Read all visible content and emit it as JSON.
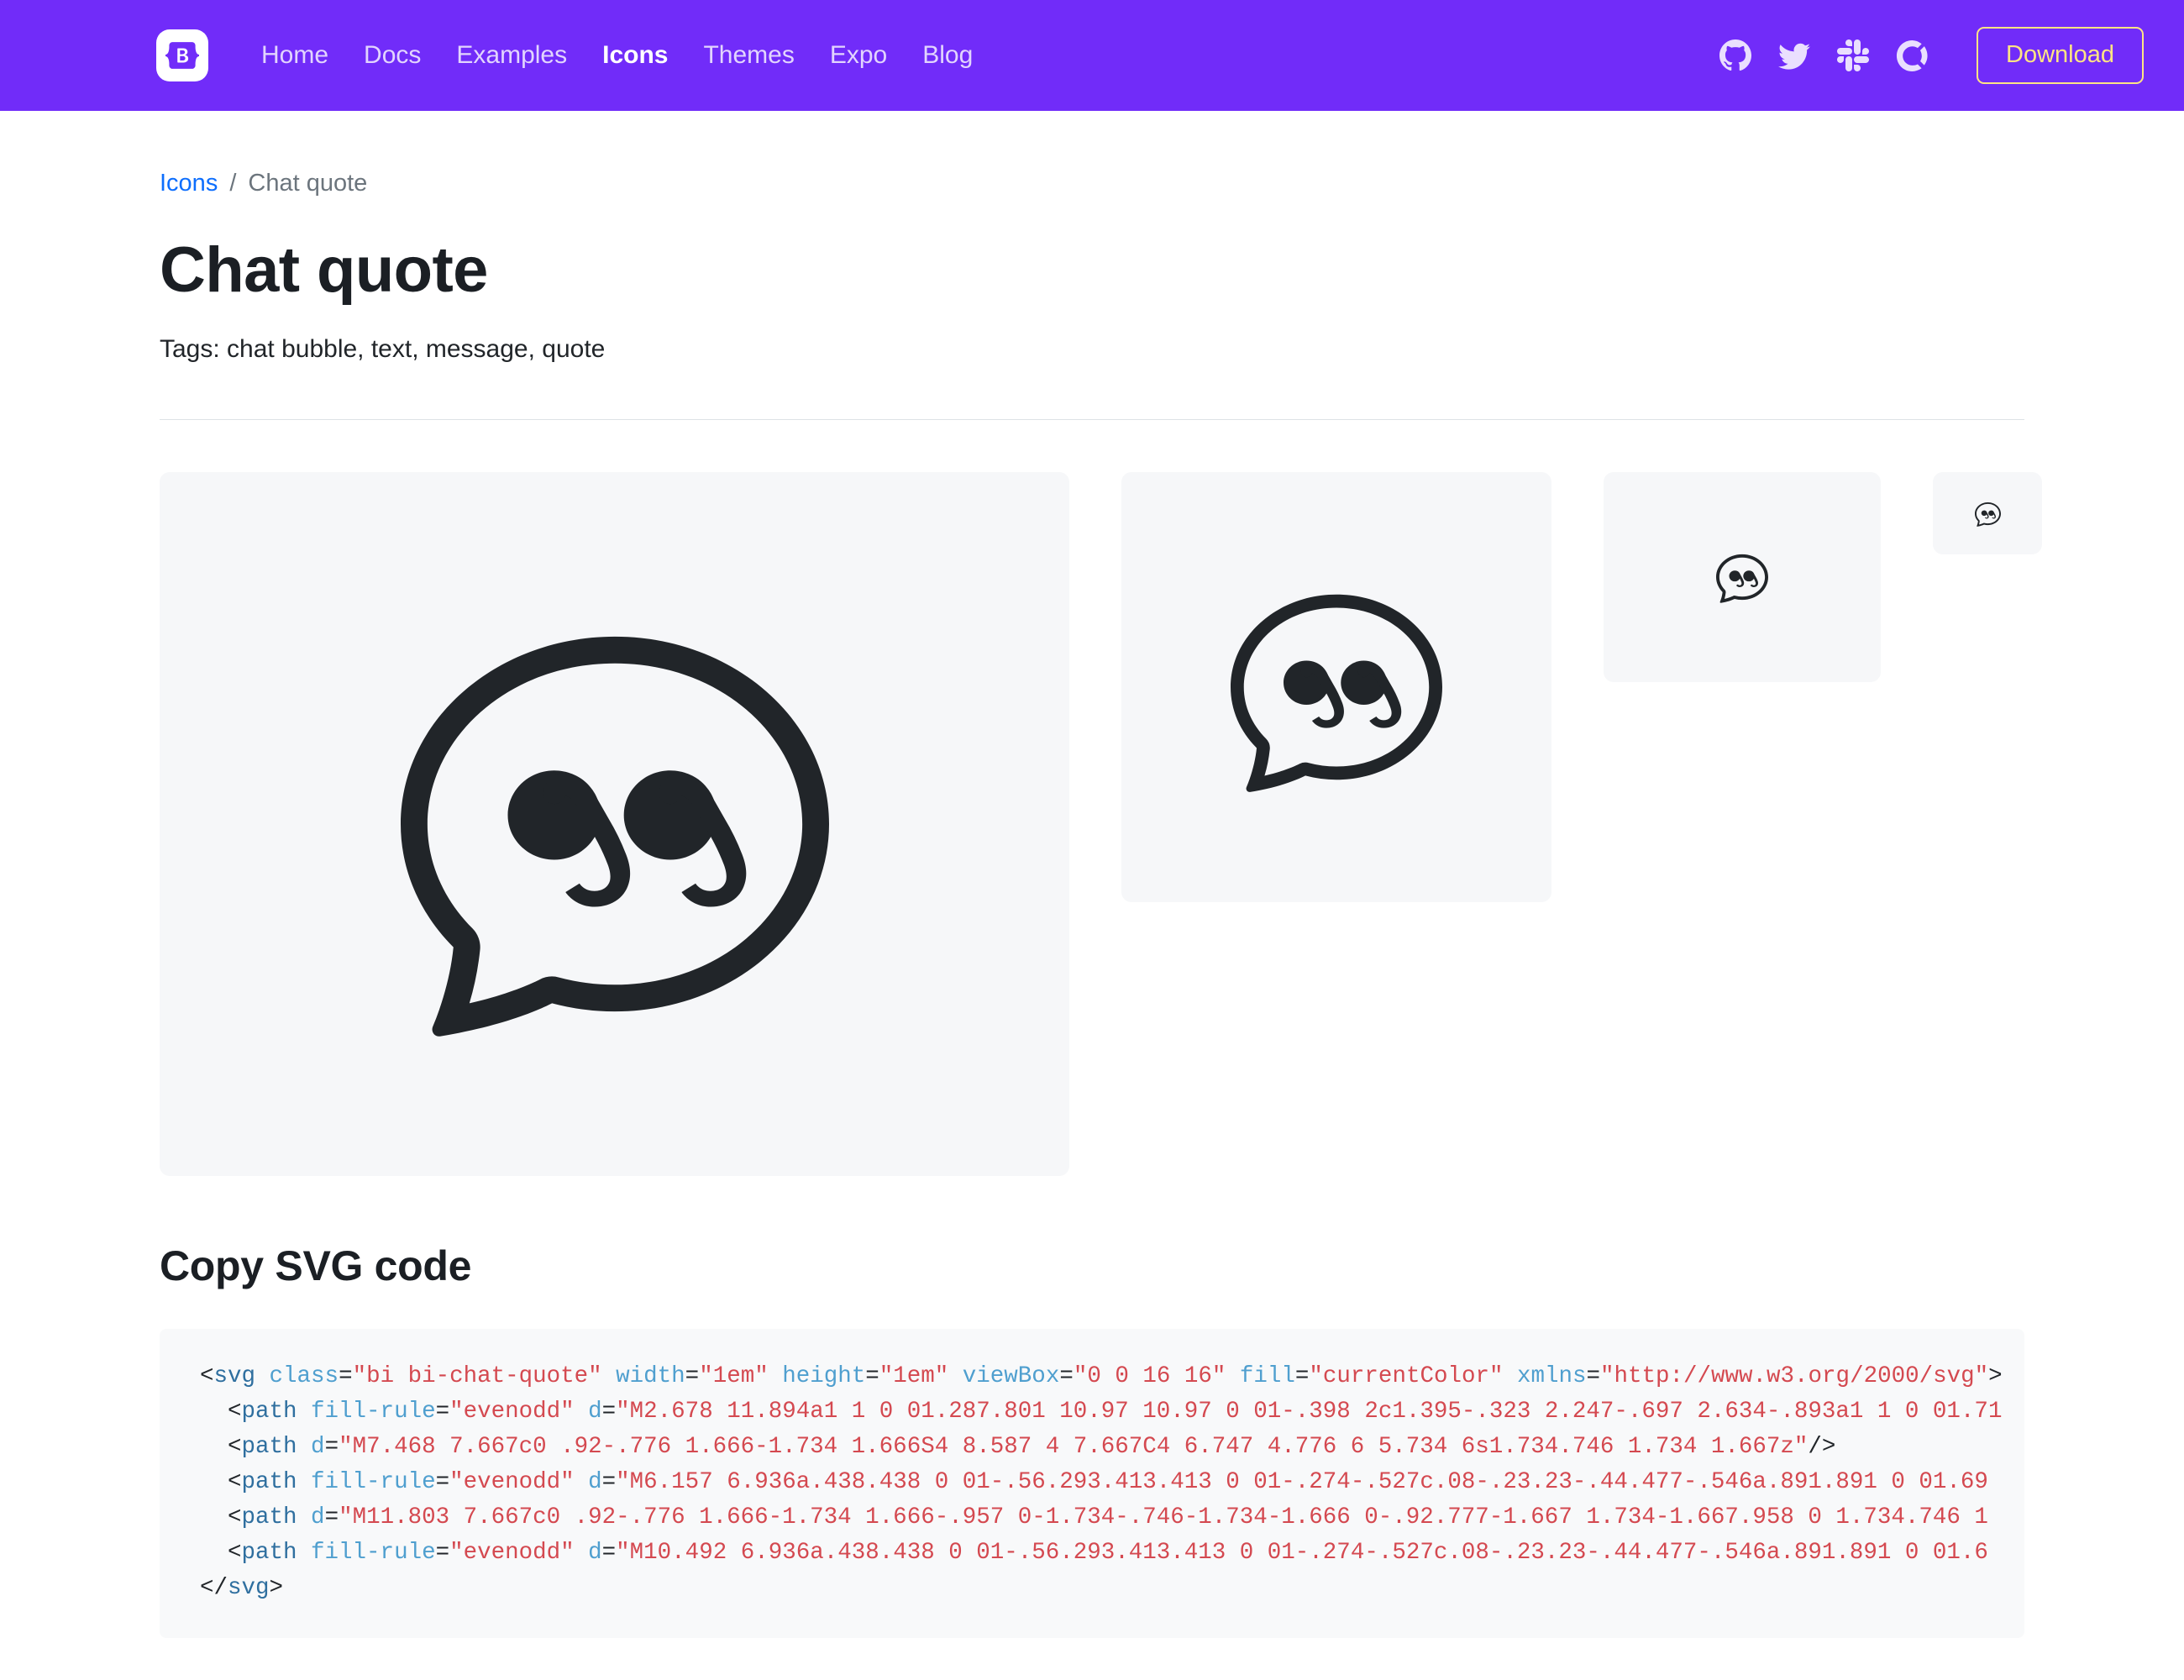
{
  "navbar": {
    "brand_letter": "B",
    "brand_name": "bootstrap-logo",
    "links": [
      {
        "label": "Home",
        "active": false
      },
      {
        "label": "Docs",
        "active": false
      },
      {
        "label": "Examples",
        "active": false
      },
      {
        "label": "Icons",
        "active": true
      },
      {
        "label": "Themes",
        "active": false
      },
      {
        "label": "Expo",
        "active": false
      },
      {
        "label": "Blog",
        "active": false
      }
    ],
    "social": [
      {
        "icon": "github-icon",
        "name": "GitHub"
      },
      {
        "icon": "twitter-icon",
        "name": "Twitter"
      },
      {
        "icon": "slack-icon",
        "name": "Slack"
      },
      {
        "icon": "open-collective-icon",
        "name": "Open Collective"
      }
    ],
    "download_label": "Download",
    "bg_color": "#712cf9",
    "download_color": "#ffe484"
  },
  "breadcrumb": {
    "parent": "Icons",
    "separator": "/",
    "current": "Chat quote"
  },
  "page": {
    "title": "Chat quote",
    "tags_label": "Tags:",
    "tags": "chat bubble, text, message, quote",
    "tags_line": "Tags: chat bubble, text, message, quote"
  },
  "previews": {
    "box_bg": "#f6f7f9",
    "icon_color": "#212529",
    "items": [
      {
        "size_label": "8rem",
        "px": 211
      },
      {
        "size_label": "4rem",
        "px": 105
      },
      {
        "size_label": "2rem",
        "px": 53
      },
      {
        "size_label": "1rem",
        "px": 26
      }
    ]
  },
  "code_section": {
    "heading": "Copy SVG code",
    "bg_color": "#f8f9fa",
    "lines": [
      [
        {
          "t": "tg",
          "v": "<"
        },
        {
          "t": "nm",
          "v": "svg"
        },
        {
          "t": "tg",
          "v": " "
        },
        {
          "t": "at",
          "v": "class"
        },
        {
          "t": "eq",
          "v": "="
        },
        {
          "t": "st",
          "v": "\"bi bi-chat-quote\""
        },
        {
          "t": "tg",
          "v": " "
        },
        {
          "t": "at",
          "v": "width"
        },
        {
          "t": "eq",
          "v": "="
        },
        {
          "t": "st",
          "v": "\"1em\""
        },
        {
          "t": "tg",
          "v": " "
        },
        {
          "t": "at",
          "v": "height"
        },
        {
          "t": "eq",
          "v": "="
        },
        {
          "t": "st",
          "v": "\"1em\""
        },
        {
          "t": "tg",
          "v": " "
        },
        {
          "t": "at",
          "v": "viewBox"
        },
        {
          "t": "eq",
          "v": "="
        },
        {
          "t": "st",
          "v": "\"0 0 16 16\""
        },
        {
          "t": "tg",
          "v": " "
        },
        {
          "t": "at",
          "v": "fill"
        },
        {
          "t": "eq",
          "v": "="
        },
        {
          "t": "st",
          "v": "\"currentColor\""
        },
        {
          "t": "tg",
          "v": " "
        },
        {
          "t": "at",
          "v": "xmlns"
        },
        {
          "t": "eq",
          "v": "="
        },
        {
          "t": "st",
          "v": "\"http://www.w3.org/2000/svg\""
        },
        {
          "t": "tg",
          "v": ">"
        }
      ],
      [
        {
          "t": "tg",
          "v": "  <"
        },
        {
          "t": "nm",
          "v": "path"
        },
        {
          "t": "tg",
          "v": " "
        },
        {
          "t": "at",
          "v": "fill-rule"
        },
        {
          "t": "eq",
          "v": "="
        },
        {
          "t": "st",
          "v": "\"evenodd\""
        },
        {
          "t": "tg",
          "v": " "
        },
        {
          "t": "at",
          "v": "d"
        },
        {
          "t": "eq",
          "v": "="
        },
        {
          "t": "st",
          "v": "\"M2.678 11.894a1 1 0 01.287.801 10.97 10.97 0 01-.398 2c1.395-.323 2.247-.697 2.634-.893a1 1 0 01.71"
        }
      ],
      [
        {
          "t": "tg",
          "v": "  <"
        },
        {
          "t": "nm",
          "v": "path"
        },
        {
          "t": "tg",
          "v": " "
        },
        {
          "t": "at",
          "v": "d"
        },
        {
          "t": "eq",
          "v": "="
        },
        {
          "t": "st",
          "v": "\"M7.468 7.667c0 .92-.776 1.666-1.734 1.666S4 8.587 4 7.667C4 6.747 4.776 6 5.734 6s1.734.746 1.734 1.667z\""
        },
        {
          "t": "tg",
          "v": "/>"
        }
      ],
      [
        {
          "t": "tg",
          "v": "  <"
        },
        {
          "t": "nm",
          "v": "path"
        },
        {
          "t": "tg",
          "v": " "
        },
        {
          "t": "at",
          "v": "fill-rule"
        },
        {
          "t": "eq",
          "v": "="
        },
        {
          "t": "st",
          "v": "\"evenodd\""
        },
        {
          "t": "tg",
          "v": " "
        },
        {
          "t": "at",
          "v": "d"
        },
        {
          "t": "eq",
          "v": "="
        },
        {
          "t": "st",
          "v": "\"M6.157 6.936a.438.438 0 01-.56.293.413.413 0 01-.274-.527c.08-.23.23-.44.477-.546a.891.891 0 01.69"
        }
      ],
      [
        {
          "t": "tg",
          "v": "  <"
        },
        {
          "t": "nm",
          "v": "path"
        },
        {
          "t": "tg",
          "v": " "
        },
        {
          "t": "at",
          "v": "d"
        },
        {
          "t": "eq",
          "v": "="
        },
        {
          "t": "st",
          "v": "\"M11.803 7.667c0 .92-.776 1.666-1.734 1.666-.957 0-1.734-.746-1.734-1.666 0-.92.777-1.667 1.734-1.667.958 0 1.734.746 1"
        }
      ],
      [
        {
          "t": "tg",
          "v": "  <"
        },
        {
          "t": "nm",
          "v": "path"
        },
        {
          "t": "tg",
          "v": " "
        },
        {
          "t": "at",
          "v": "fill-rule"
        },
        {
          "t": "eq",
          "v": "="
        },
        {
          "t": "st",
          "v": "\"evenodd\""
        },
        {
          "t": "tg",
          "v": " "
        },
        {
          "t": "at",
          "v": "d"
        },
        {
          "t": "eq",
          "v": "="
        },
        {
          "t": "st",
          "v": "\"M10.492 6.936a.438.438 0 01-.56.293.413.413 0 01-.274-.527c.08-.23.23-.44.477-.546a.891.891 0 01.6"
        }
      ],
      [
        {
          "t": "tg",
          "v": "</"
        },
        {
          "t": "nm",
          "v": "svg"
        },
        {
          "t": "tg",
          "v": ">"
        }
      ]
    ]
  }
}
